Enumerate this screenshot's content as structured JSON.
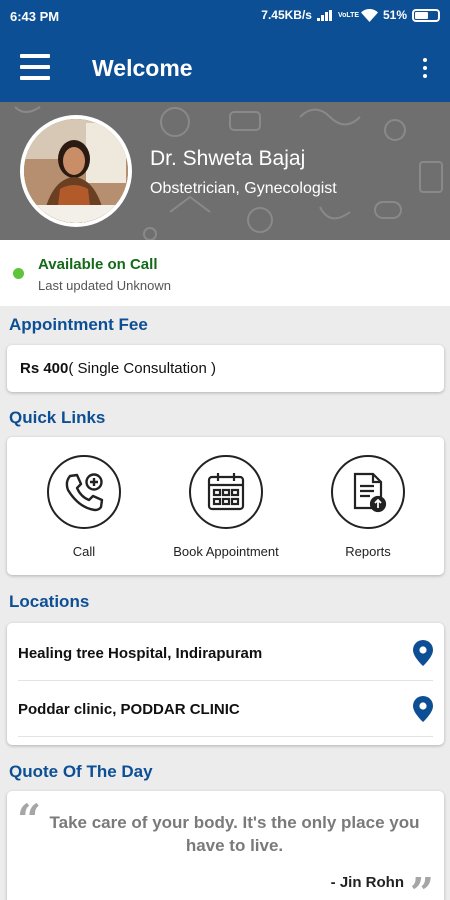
{
  "status_bar": {
    "time": "6:43 PM",
    "net_speed": "7.45KB/s",
    "lte1": "VoLTE",
    "battery": "51%"
  },
  "app_bar": {
    "title": "Welcome",
    "menu_icon": "hamburger-icon",
    "overflow_icon": "more-vert-icon"
  },
  "profile": {
    "name": "Dr. Shweta Bajaj",
    "specialty": "Obstetrician, Gynecologist"
  },
  "availability": {
    "status": "Available on Call",
    "updated": "Last updated Unknown",
    "status_color": "#5ec53a"
  },
  "appointment_fee": {
    "heading": "Appointment Fee",
    "amount": "Rs 400",
    "detail": "( Single Consultation )"
  },
  "quick_links": {
    "heading": "Quick Links",
    "items": [
      {
        "label": "Call",
        "icon": "phone-plus-icon"
      },
      {
        "label": "Book Appointment",
        "icon": "calendar-icon"
      },
      {
        "label": "Reports",
        "icon": "report-upload-icon"
      }
    ]
  },
  "locations": {
    "heading": "Locations",
    "items": [
      {
        "name": "Healing tree Hospital, Indirapuram",
        "icon": "map-pin-icon"
      },
      {
        "name": "Poddar clinic, PODDAR CLINIC",
        "icon": "map-pin-icon"
      }
    ]
  },
  "quote": {
    "heading": "Quote Of The Day",
    "text": "Take care of your body. It's the only place you have to live.",
    "author": "- Jin Rohn"
  },
  "colors": {
    "primary": "#0d4f94",
    "available_text": "#146a19"
  }
}
